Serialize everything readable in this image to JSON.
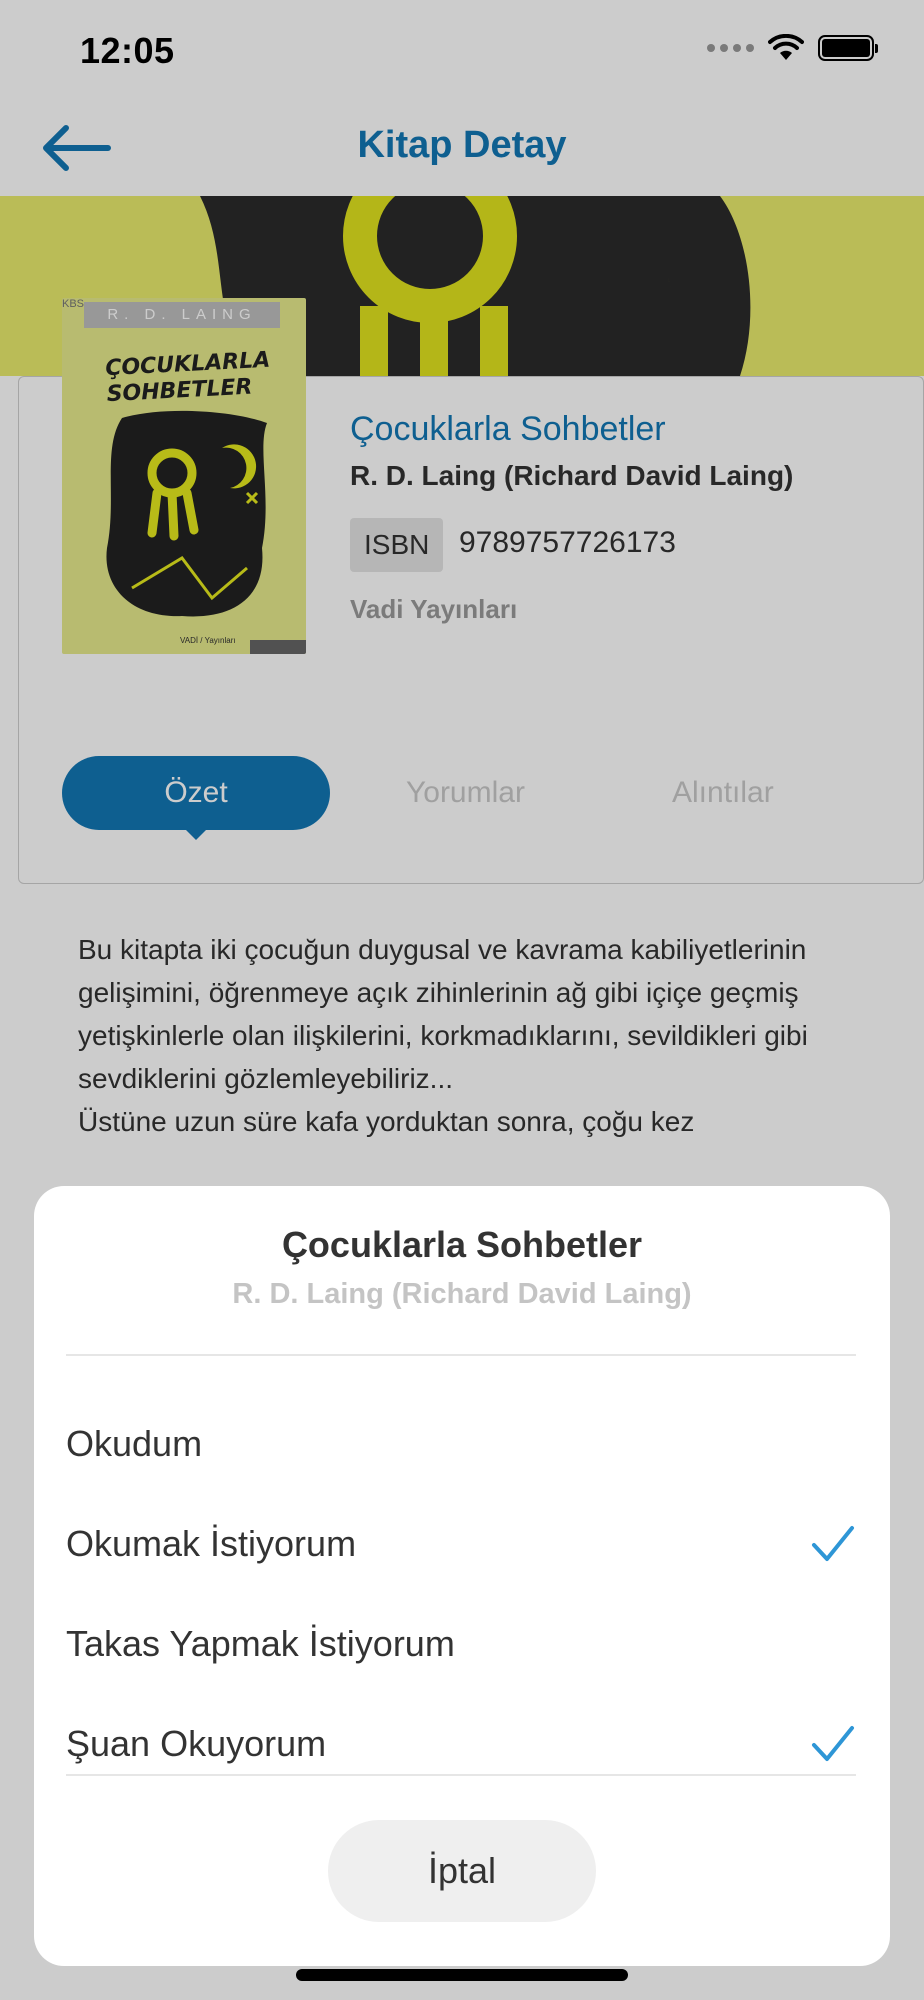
{
  "status_bar": {
    "time": "12:05"
  },
  "nav": {
    "title": "Kitap Detay",
    "back_icon": "arrow-left-icon"
  },
  "book": {
    "title": "Çocuklarla Sohbetler",
    "author": "R. D. Laing (Richard David  Laing)",
    "isbn_label": "ISBN",
    "isbn": "9789757726173",
    "publisher": "Vadi Yayınları",
    "cover": {
      "top_text": "R. D. LAING",
      "title_text": "ÇOCUKLARLA SOHBETLER",
      "corner_text": "KBS",
      "bottom_text": "VADİ / Yayınları"
    }
  },
  "tabs": [
    {
      "label": "Özet",
      "active": true
    },
    {
      "label": "Yorumlar",
      "active": false
    },
    {
      "label": "Alıntılar",
      "active": false
    }
  ],
  "summary": {
    "line1": "Bu kitapta iki çocuğun duygusal ve kavrama kabiliyetlerinin gelişimini, öğrenmeye açık zihinlerinin ağ gibi içiçe geçmiş yetişkinlerle olan ilişkilerini, korkmadıklarını, sevildikleri gibi sevdiklerini gözlemleyebiliriz...",
    "line2": "Üstüne uzun süre kafa yorduktan sonra, çoğu kez"
  },
  "sheet": {
    "title": "Çocuklarla Sohbetler",
    "subtitle": "R. D. Laing (Richard David  Laing)",
    "options": [
      {
        "label": "Okudum",
        "checked": false
      },
      {
        "label": "Okumak İstiyorum",
        "checked": true
      },
      {
        "label": "Takas Yapmak İstiyorum",
        "checked": false
      },
      {
        "label": "Şuan Okuyorum",
        "checked": true
      }
    ],
    "cancel_label": "İptal"
  },
  "colors": {
    "accent": "#1277b5",
    "check": "#2e96d6",
    "banner": "#e9ec6d"
  }
}
